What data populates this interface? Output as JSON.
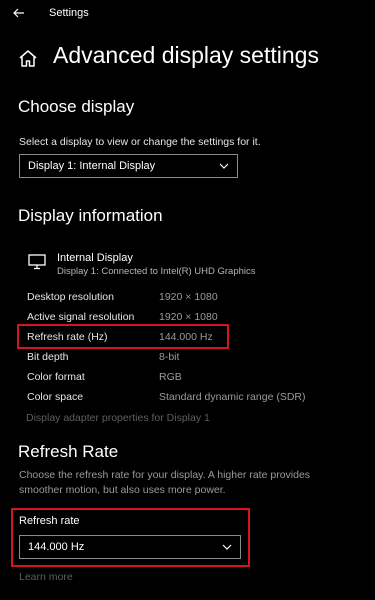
{
  "window": {
    "title": "Settings"
  },
  "page": {
    "title": "Advanced display settings"
  },
  "choose_display": {
    "heading": "Choose display",
    "description": "Select a display to view or change the settings for it.",
    "selected": "Display 1: Internal Display"
  },
  "display_info": {
    "heading": "Display information",
    "device_name": "Internal Display",
    "device_sub": "Display 1: Connected to Intel(R) UHD Graphics",
    "rows": [
      {
        "label": "Desktop resolution",
        "value": "1920 × 1080"
      },
      {
        "label": "Active signal resolution",
        "value": "1920 × 1080"
      },
      {
        "label": "Refresh rate (Hz)",
        "value": "144.000 Hz"
      },
      {
        "label": "Bit depth",
        "value": "8-bit"
      },
      {
        "label": "Color format",
        "value": "RGB"
      },
      {
        "label": "Color space",
        "value": "Standard dynamic range (SDR)"
      }
    ],
    "adapter_link": "Display adapter properties for Display 1"
  },
  "refresh_rate": {
    "heading": "Refresh Rate",
    "description_line1": "Choose the refresh rate for your display. A higher rate provides",
    "description_line2": "smoother motion, but also uses more power.",
    "label": "Refresh rate",
    "selected": "144.000 Hz",
    "learn_more": "Learn more"
  },
  "icons": {
    "back": "back-arrow-icon",
    "home": "home-icon",
    "monitor": "monitor-icon",
    "dropdown": "chevron-down-icon"
  },
  "colors": {
    "background": "#000000",
    "highlight": "#d4141f",
    "muted_text": "#9a9a9a",
    "disabled_link": "#5f5f5f"
  }
}
